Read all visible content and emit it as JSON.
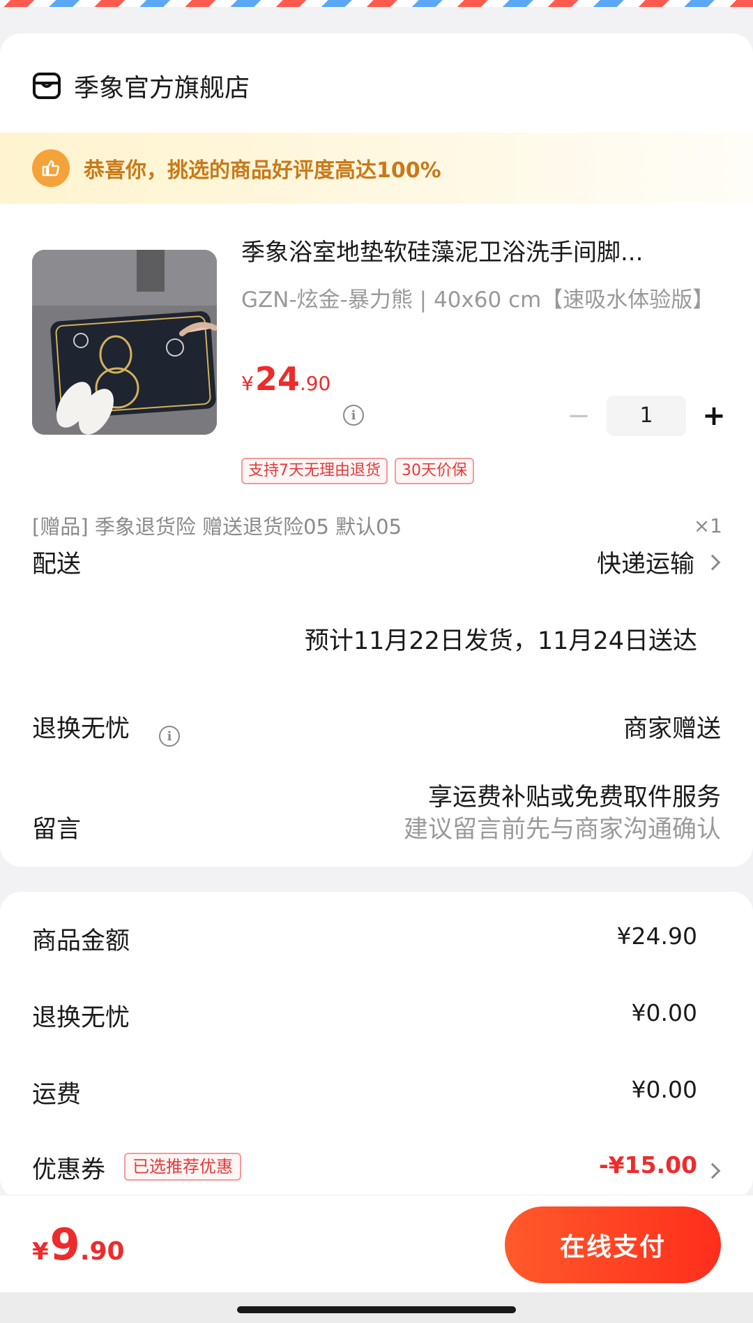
{
  "store": {
    "name": "季象官方旗舰店",
    "icon": "store-icon"
  },
  "praise": {
    "text": "恭喜你，挑选的商品好评度高达100%",
    "icon": "thumbs-up-icon"
  },
  "product": {
    "title": "季象浴室地垫软硅藻泥卫浴洗手间脚...",
    "spec": "GZN-炫金-暴力熊 | 40x60 cm【速吸水体验版】",
    "price_symbol": "¥",
    "price_int": "24",
    "price_dec": ".90",
    "quantity": "1",
    "tags": [
      "支持7天无理由退货",
      "30天价保"
    ]
  },
  "gift": {
    "text": "[赠品] 季象退货险 赠送退货险05 默认05",
    "qty": "×1"
  },
  "delivery": {
    "label": "配送",
    "method": "快递运输",
    "estimate": "预计11月22日发货，11月24日送达"
  },
  "returns": {
    "label": "退换无忧",
    "value": "商家赠送",
    "subtext": "享运费补贴或免费取件服务"
  },
  "message": {
    "label": "留言",
    "placeholder": "建议留言前先与商家沟通确认"
  },
  "summary": {
    "goods_label": "商品金额",
    "goods_value": "¥24.90",
    "returns_label": "退换无忧",
    "returns_value": "¥0.00",
    "shipping_label": "运费",
    "shipping_value": "¥0.00",
    "coupon_label": "优惠券",
    "coupon_tag": "已选推荐优惠",
    "coupon_value": "-¥15.00"
  },
  "footer": {
    "total_symbol": "¥",
    "total_int": "9",
    "total_dec": ".90",
    "pay_label": "在线支付"
  },
  "colors": {
    "accent": "#ee2b2b",
    "praise_text": "#c97918",
    "pay_button": "#ff3b22"
  }
}
